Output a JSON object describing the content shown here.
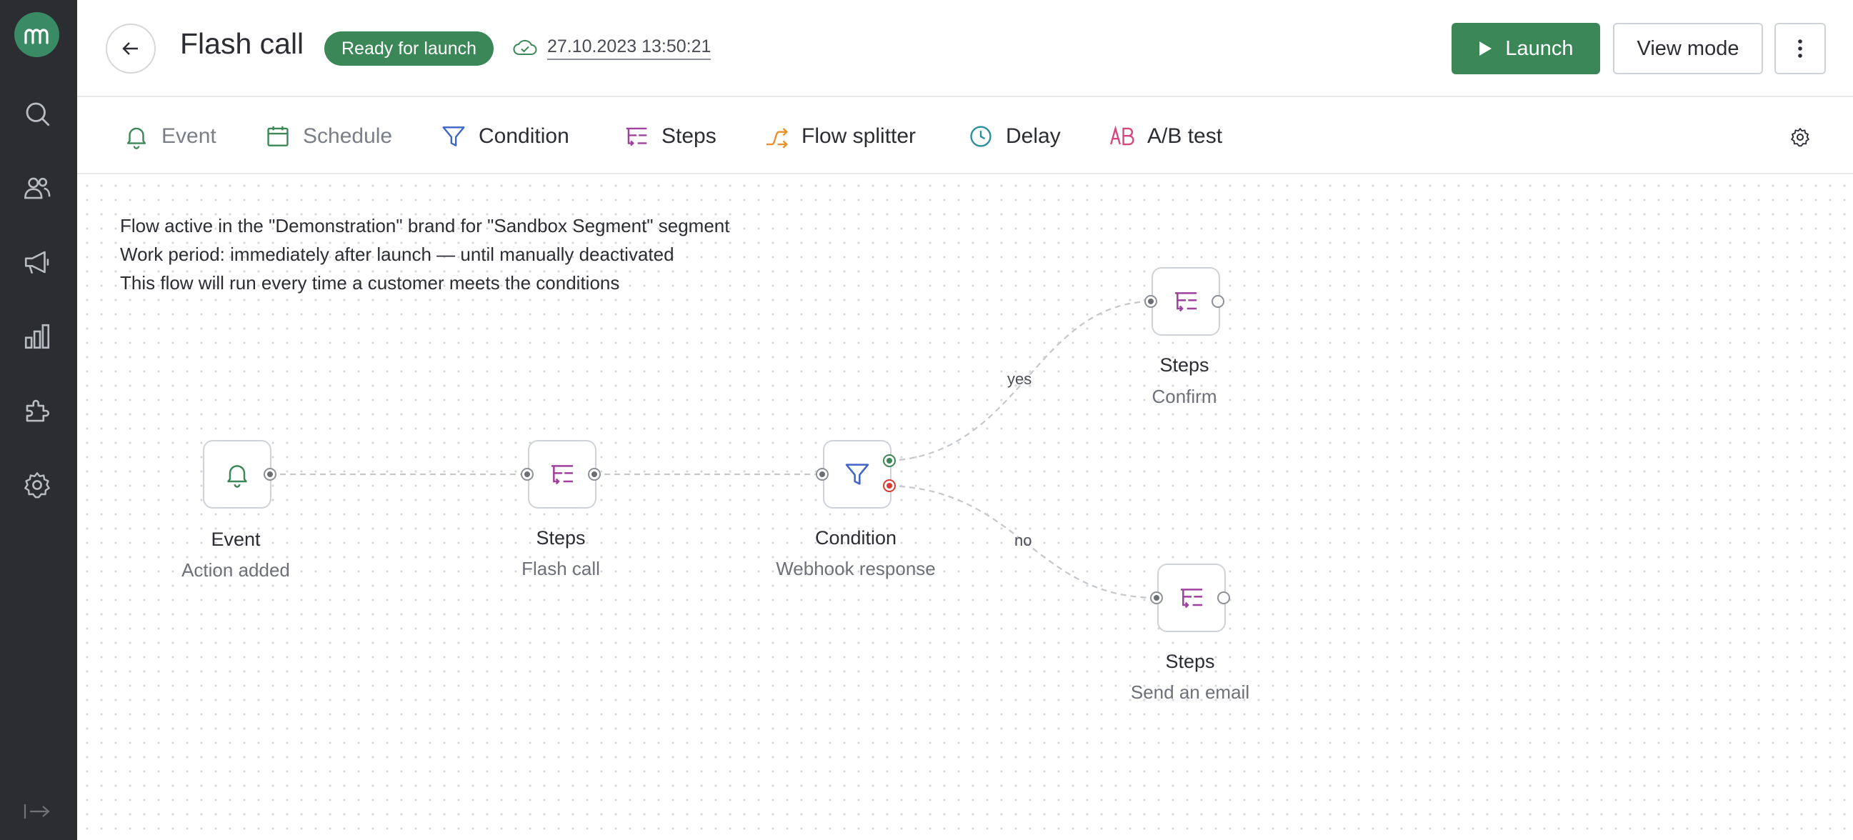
{
  "sidebar": {
    "logo_icon": "mindbox-logo",
    "items": [
      {
        "icon": "search-icon"
      },
      {
        "icon": "users-icon"
      },
      {
        "icon": "megaphone-icon"
      },
      {
        "icon": "analytics-icon"
      },
      {
        "icon": "puzzle-icon"
      },
      {
        "icon": "gear-icon"
      }
    ],
    "collapse_icon": "expand-arrow-icon"
  },
  "header": {
    "title": "Flash call",
    "status": "Ready for launch",
    "saved_at": "27.10.2023 13:50:21",
    "launch_label": "Launch",
    "view_mode_label": "View mode",
    "accent": "#3b8757"
  },
  "toolbar": {
    "items": [
      {
        "label": "Event",
        "icon": "bell-icon"
      },
      {
        "label": "Schedule",
        "icon": "calendar-icon"
      },
      {
        "label": "Condition",
        "icon": "funnel-icon"
      },
      {
        "label": "Steps",
        "icon": "steps-icon"
      },
      {
        "label": "Flow splitter",
        "icon": "splitter-icon"
      },
      {
        "label": "Delay",
        "icon": "clock-icon"
      },
      {
        "label": "A/B test",
        "icon": "ab-icon"
      }
    ]
  },
  "canvas": {
    "info_lines": [
      "Flow active in the \"Demonstration\" brand for \"Sandbox Segment\" segment",
      "Work period: immediately after launch — until manually deactivated",
      "This flow will run every time a customer meets the conditions"
    ],
    "nodes": {
      "event": {
        "title": "Event",
        "subtitle": "Action added"
      },
      "steps_flash": {
        "title": "Steps",
        "subtitle": "Flash call"
      },
      "condition": {
        "title": "Condition",
        "subtitle": "Webhook response"
      },
      "steps_confirm": {
        "title": "Steps",
        "subtitle": "Confirm"
      },
      "steps_email": {
        "title": "Steps",
        "subtitle": "Send an email"
      }
    },
    "edge_labels": {
      "yes": "yes",
      "no": "no"
    }
  }
}
